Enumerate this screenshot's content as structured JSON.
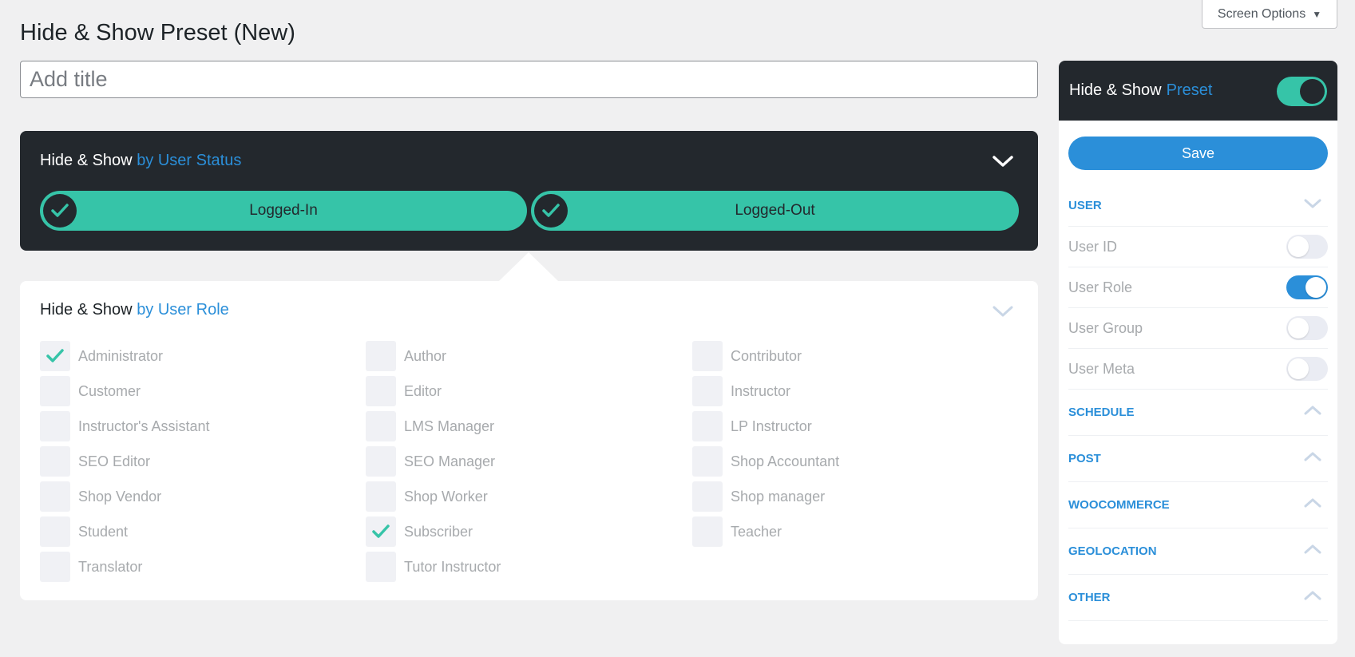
{
  "screen_options": {
    "label": "Screen Options"
  },
  "page": {
    "title": "Hide & Show Preset (New)",
    "title_placeholder": "Add title"
  },
  "user_status": {
    "heading_prefix": "Hide & Show",
    "heading_accent": "by User Status",
    "options": [
      {
        "label": "Logged-In",
        "checked": true
      },
      {
        "label": "Logged-Out",
        "checked": true
      }
    ]
  },
  "user_role": {
    "heading_prefix": "Hide & Show",
    "heading_accent": "by User Role",
    "roles": [
      {
        "label": "Administrator",
        "checked": true
      },
      {
        "label": "Author",
        "checked": false
      },
      {
        "label": "Contributor",
        "checked": false
      },
      {
        "label": "Customer",
        "checked": false
      },
      {
        "label": "Editor",
        "checked": false
      },
      {
        "label": "Instructor",
        "checked": false
      },
      {
        "label": "Instructor's Assistant",
        "checked": false
      },
      {
        "label": "LMS Manager",
        "checked": false
      },
      {
        "label": "LP Instructor",
        "checked": false
      },
      {
        "label": "SEO Editor",
        "checked": false
      },
      {
        "label": "SEO Manager",
        "checked": false
      },
      {
        "label": "Shop Accountant",
        "checked": false
      },
      {
        "label": "Shop Vendor",
        "checked": false
      },
      {
        "label": "Shop Worker",
        "checked": false
      },
      {
        "label": "Shop manager",
        "checked": false
      },
      {
        "label": "Student",
        "checked": false
      },
      {
        "label": "Subscriber",
        "checked": true
      },
      {
        "label": "Teacher",
        "checked": false
      },
      {
        "label": "Translator",
        "checked": false
      },
      {
        "label": "Tutor Instructor",
        "checked": false
      }
    ]
  },
  "sidebar": {
    "heading_prefix": "Hide & Show",
    "heading_accent": "Preset",
    "enabled": true,
    "save_label": "Save",
    "user_section": "USER",
    "user_items": [
      {
        "label": "User ID",
        "on": false
      },
      {
        "label": "User Role",
        "on": true
      },
      {
        "label": "User Group",
        "on": false
      },
      {
        "label": "User Meta",
        "on": false
      }
    ],
    "sections": [
      "SCHEDULE",
      "POST",
      "WOOCOMMERCE",
      "GEOLOCATION",
      "OTHER"
    ]
  },
  "colors": {
    "accent_blue": "#2b8fd9",
    "accent_green": "#36c4a8",
    "dark": "#23282d"
  }
}
